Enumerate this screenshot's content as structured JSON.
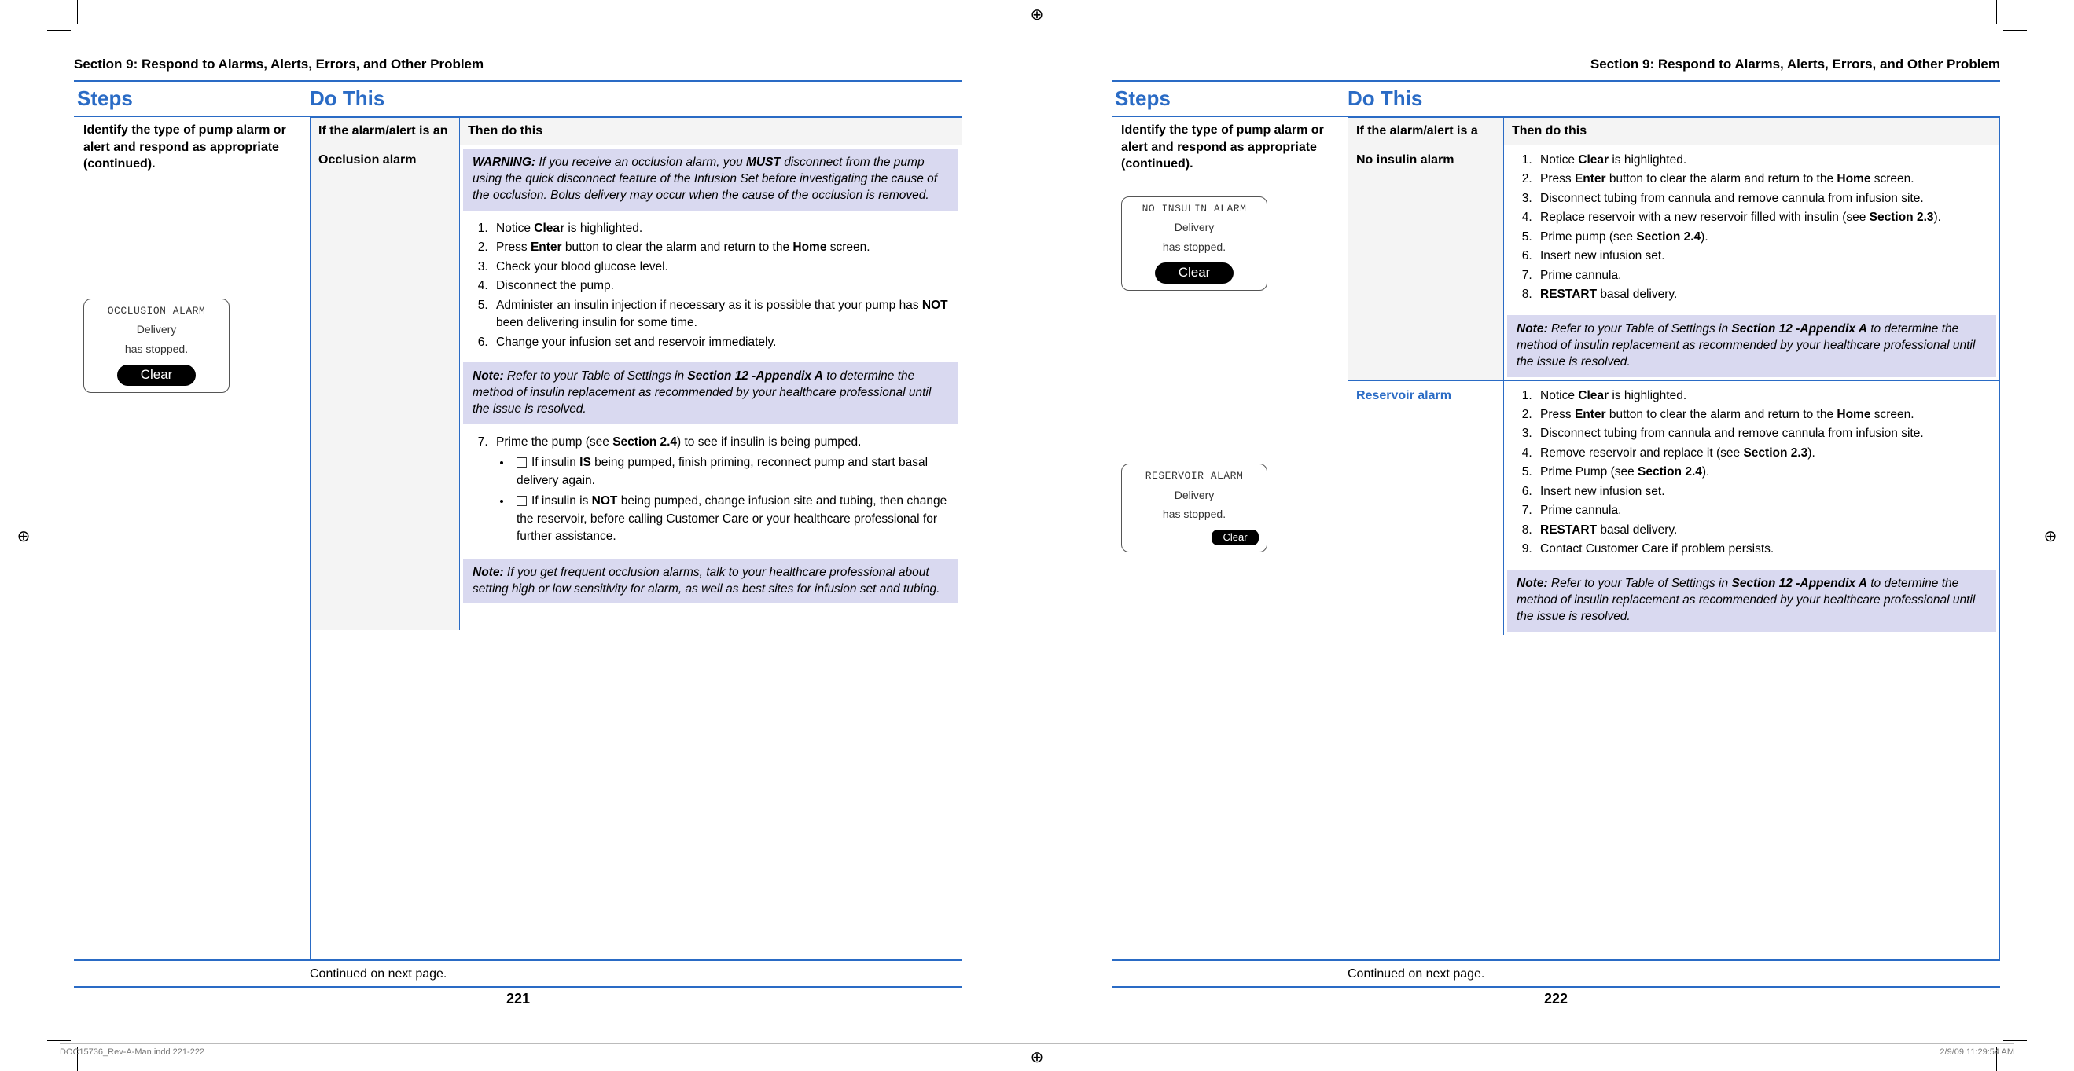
{
  "section_title": "Section 9: Respond to Alarms, Alerts, Errors, and Other Problem",
  "headings": {
    "steps": "Steps",
    "do_this": "Do This"
  },
  "tbl_head": {
    "col1a": "If the alarm/alert is an",
    "col1b": "If the alarm/alert is a",
    "col2": "Then do this"
  },
  "step_text": "Identify the type of pump alarm or alert and respond as appropriate (continued).",
  "continued": "Continued on next page.",
  "page_left_num": "221",
  "page_right_num": "222",
  "footer": {
    "file": "DOC15736_Rev-A-Man.indd   221-222",
    "stamp": "2/9/09   11:29:54 AM"
  },
  "pump_occ": {
    "title": "OCCLUSION ALARM",
    "l1": "Delivery",
    "l2": "has stopped.",
    "btn": "Clear"
  },
  "pump_noins": {
    "title": "NO INSULIN ALARM",
    "l1": "Delivery",
    "l2": "has stopped.",
    "btn": "Clear"
  },
  "pump_res": {
    "title": "RESERVOIR ALARM",
    "l1": "Delivery",
    "l2": "has stopped.",
    "btn": "Clear"
  },
  "occlusion": {
    "name": "Occlusion alarm",
    "warn_label": "WARNING:",
    "warn_text": " If you receive an occlusion alarm, you ",
    "warn_bold": "MUST",
    "warn_text2": " disconnect from the pump using the quick disconnect feature of the Infusion Set before investigating the cause of the occlusion. Bolus delivery may occur when the cause of the occlusion is removed.",
    "s1a": "Notice ",
    "s1b": "Clear",
    "s1c": " is highlighted.",
    "s2a": "Press ",
    "s2b": "Enter",
    "s2c": " button to clear the alarm and return to the ",
    "s2d": "Home",
    "s2e": " screen.",
    "s3": "Check your blood glucose level.",
    "s4": "Disconnect the pump.",
    "s5a": "Administer an insulin injection if necessary as it is possible that your pump has ",
    "s5b": "NOT",
    "s5c": " been delivering insulin for some time.",
    "s6": "Change your infusion set and reservoir immediately.",
    "note1_label": "Note:",
    "note1a": " Refer to your Table of Settings in ",
    "note1b": "Section 12 -Appendix A",
    "note1c": " to determine the method of insulin replacement as recommended by your healthcare professional until the issue is resolved.",
    "s7a": "Prime the pump (see ",
    "s7b": "Section 2.4",
    "s7c": ") to see if insulin is being pumped.",
    "b1a": "If insulin ",
    "b1b": "IS",
    "b1c": " being pumped, finish priming, reconnect pump and start basal delivery again.",
    "b2a": "If insulin is ",
    "b2b": "NOT",
    "b2c": " being pumped, change infusion site and tubing, then change the reservoir, before calling Customer Care or your healthcare professional for further assistance.",
    "note2_label": "Note:",
    "note2": " If you get frequent occlusion alarms, talk to your healthcare professional about setting high or low sensitivity for alarm, as well as best sites for infusion set and tubing."
  },
  "noins": {
    "name": "No insulin alarm",
    "s1a": "Notice ",
    "s1b": "Clear",
    "s1c": " is highlighted.",
    "s2a": "Press ",
    "s2b": "Enter",
    "s2c": " button to clear the alarm and return to the ",
    "s2d": "Home",
    "s2e": " screen.",
    "s3": "Disconnect tubing from cannula and remove cannula from infusion site.",
    "s4a": "Replace reservoir with a new reservoir filled with insulin (see ",
    "s4b": "Section 2.3",
    "s4c": ").",
    "s5a": "Prime pump (see ",
    "s5b": "Section 2.4",
    "s5c": ").",
    "s6": "Insert new infusion set.",
    "s7": "Prime cannula.",
    "s8a": "RESTART",
    "s8b": " basal delivery.",
    "note_label": "Note:",
    "note_a": " Refer to your Table of Settings in ",
    "note_b": "Section 12 -Appendix A",
    "note_c": " to determine the method of insulin replacement as recommended by your healthcare professional until the issue is resolved."
  },
  "reserv": {
    "name": "Reservoir alarm",
    "s1a": "Notice ",
    "s1b": "Clear",
    "s1c": " is highlighted.",
    "s2a": "Press ",
    "s2b": "Enter",
    "s2c": " button to clear the alarm and return to the ",
    "s2d": "Home",
    "s2e": " screen.",
    "s3": "Disconnect tubing from cannula and remove cannula from infusion site.",
    "s4a": "Remove reservoir and replace it (see ",
    "s4b": "Section 2.3",
    "s4c": ").",
    "s5a": "Prime Pump (see ",
    "s5b": "Section 2.4",
    "s5c": ").",
    "s6": "Insert new infusion set.",
    "s7": "Prime cannula.",
    "s8a": "RESTART",
    "s8b": " basal delivery.",
    "s9": "Contact Customer Care if problem persists.",
    "note_label": "Note:",
    "note_a": " Refer to your Table of Settings in ",
    "note_b": "Section 12 -Appendix A",
    "note_c": " to determine the method of insulin replacement as recommended by your healthcare professional until the issue is resolved."
  }
}
